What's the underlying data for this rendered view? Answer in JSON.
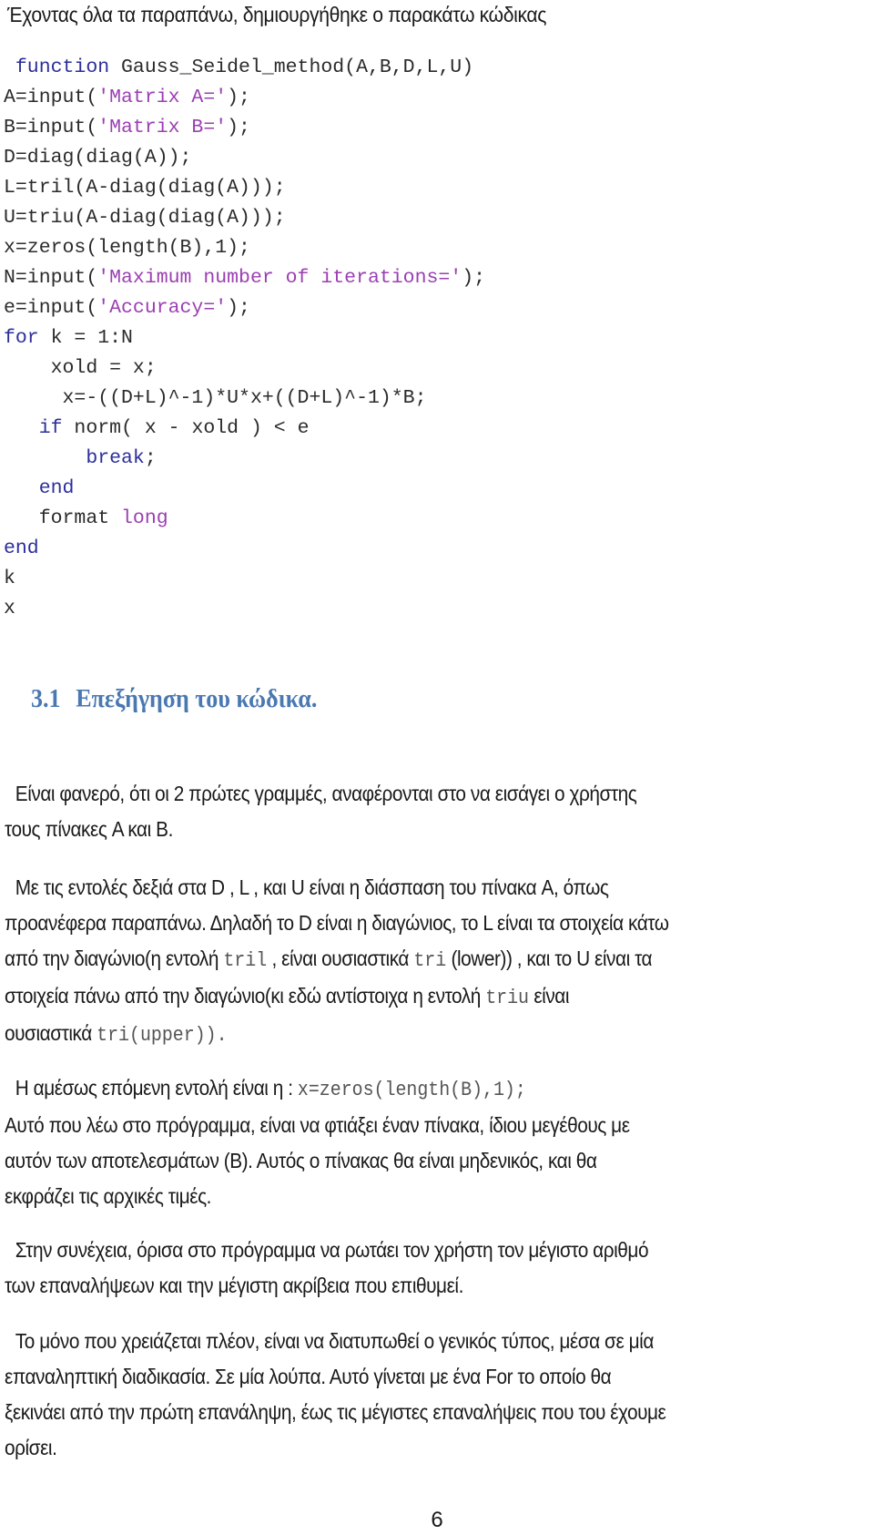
{
  "intro": "Έχοντας όλα τα παραπάνω, δημιουργήθηκε ο παρακάτω κώδικας",
  "code": {
    "lines": [
      [
        {
          "t": " ",
          "c": ""
        },
        {
          "t": "function",
          "c": "kw"
        },
        {
          "t": " Gauss_Seidel_method(A,B,D,L,U)",
          "c": ""
        }
      ],
      [
        {
          "t": "A=input(",
          "c": ""
        },
        {
          "t": "'Matrix A='",
          "c": "str"
        },
        {
          "t": ");",
          "c": ""
        }
      ],
      [
        {
          "t": "B=input(",
          "c": ""
        },
        {
          "t": "'Matrix B='",
          "c": "str"
        },
        {
          "t": ");",
          "c": ""
        }
      ],
      [
        {
          "t": "D=diag(diag(A));",
          "c": ""
        }
      ],
      [
        {
          "t": "L=tril(A-diag(diag(A)));",
          "c": ""
        }
      ],
      [
        {
          "t": "U=triu(A-diag(diag(A)));",
          "c": ""
        }
      ],
      [
        {
          "t": "x=zeros(length(B),1);",
          "c": ""
        }
      ],
      [
        {
          "t": "N=input(",
          "c": ""
        },
        {
          "t": "'Maximum number of iterations='",
          "c": "str"
        },
        {
          "t": ");",
          "c": ""
        }
      ],
      [
        {
          "t": "e=input(",
          "c": ""
        },
        {
          "t": "'Accuracy='",
          "c": "str"
        },
        {
          "t": ");",
          "c": ""
        }
      ],
      [
        {
          "t": "for",
          "c": "kw"
        },
        {
          "t": " k = 1:N",
          "c": ""
        }
      ],
      [
        {
          "t": "    xold = x;",
          "c": ""
        }
      ],
      [
        {
          "t": "     x=-((D+L)^-1)*U*x+((D+L)^-1)*B;",
          "c": ""
        }
      ],
      [
        {
          "t": "   ",
          "c": ""
        },
        {
          "t": "if",
          "c": "kw"
        },
        {
          "t": " norm( x - xold ) < e",
          "c": ""
        }
      ],
      [
        {
          "t": "       ",
          "c": ""
        },
        {
          "t": "break",
          "c": "kw"
        },
        {
          "t": ";",
          "c": ""
        }
      ],
      [
        {
          "t": "   ",
          "c": ""
        },
        {
          "t": "end",
          "c": "kw"
        }
      ],
      [
        {
          "t": "   format ",
          "c": ""
        },
        {
          "t": "long",
          "c": "str"
        }
      ],
      [
        {
          "t": "end",
          "c": "kw"
        }
      ],
      [
        {
          "t": "k",
          "c": ""
        }
      ],
      [
        {
          "t": "x",
          "c": ""
        }
      ]
    ]
  },
  "heading": {
    "number": "3.1",
    "title": "Επεξήγηση του κώδικα."
  },
  "paragraphs": {
    "p1": {
      "line1": "Είναι φανερό, ότι οι 2 πρώτες γραμμές, αναφέρονται στο να εισάγει ο χρήστης",
      "line2": "τους πίνακες A και B."
    },
    "p2": {
      "a": "Με τις εντολές δεξιά στα D , L , και U είναι η διάσπαση του πίνακα A, όπως",
      "b": "προανέφερα παραπάνω. Δηλαδή το D είναι η διαγώνιος, το L είναι τα στοιχεία κάτω",
      "c1": "από την διαγώνιο(η εντολή ",
      "code1": "tril",
      "c2": " , είναι ουσιαστικά ",
      "code2": "tri",
      "c3": " (lower)) , και το U είναι τα",
      "d1": "στοιχεία πάνω από την διαγώνιο(κι εδώ αντίστοιχα η εντολή ",
      "code3": "triu",
      "d2": " είναι",
      "e1": "ουσιαστικά ",
      "code4": "tri(upper))."
    },
    "p3": {
      "a1": "Η αμέσως επόμενη εντολή είναι η : ",
      "code": "x=zeros(length(B),1);",
      "b": "Αυτό που λέω στο πρόγραμμα, είναι να φτιάξει έναν πίνακα, ίδιου μεγέθους με",
      "c": "αυτόν των αποτελεσμάτων (B). Αυτός ο πίνακας θα είναι μηδενικός, και θα",
      "d": "εκφράζει τις αρχικές τιμές."
    },
    "p4": {
      "a": "Στην συνέχεια, όρισα στο πρόγραμμα να ρωτάει τον χρήστη τον μέγιστο αριθμό",
      "b": "των επαναλήψεων και την μέγιστη ακρίβεια που επιθυμεί."
    },
    "p5": {
      "a": "Το μόνο που χρειάζεται πλέον, είναι να διατυπωθεί ο γενικός τύπος, μέσα σε μία",
      "b": "επαναληπτική διαδικασία. Σε μία λούπα. Αυτό γίνεται με ένα For το οποίο θα",
      "c": "ξεκινάει από την πρώτη επανάληψη, έως τις μέγιστες επαναλήψεις που του έχουμε",
      "d": "ορίσει."
    }
  },
  "page_number": "6",
  "colors": {
    "keyword": "#2c2e9a",
    "string": "#9b3fb2",
    "heading": "#4a78b2"
  }
}
